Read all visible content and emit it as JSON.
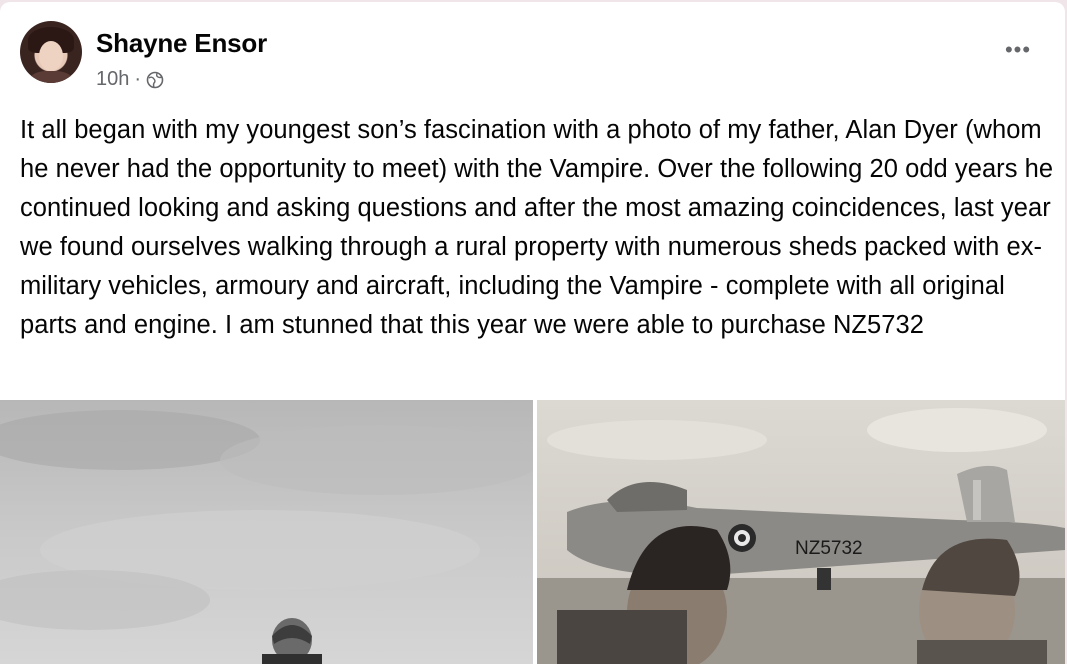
{
  "post": {
    "author": "Shayne Ensor",
    "time": "10h",
    "separator": "·",
    "audience_icon": "globe-icon",
    "more_icon": "more-options-icon",
    "more_label": "•••",
    "text": "It all began with my youngest son’s fascination with a photo of my father, Alan Dyer (whom he never had the opportunity to meet) with the Vampire. Over the following 20 odd years he continued looking and asking questions and after the most amazing coincidences, last year we found ourselves walking through a rural property with numerous sheds packed with ex-military vehicles, armoury and aircraft, including the Vampire - complete with all original parts and engine. I am stunned that this year we were able to purchase NZ5732"
  },
  "photos": {
    "right_tail_marking": "NZ5732"
  },
  "colors": {
    "text_primary": "#050505",
    "text_secondary": "#65676b",
    "card_bg": "#ffffff",
    "page_bg": "#f0e6ea"
  }
}
